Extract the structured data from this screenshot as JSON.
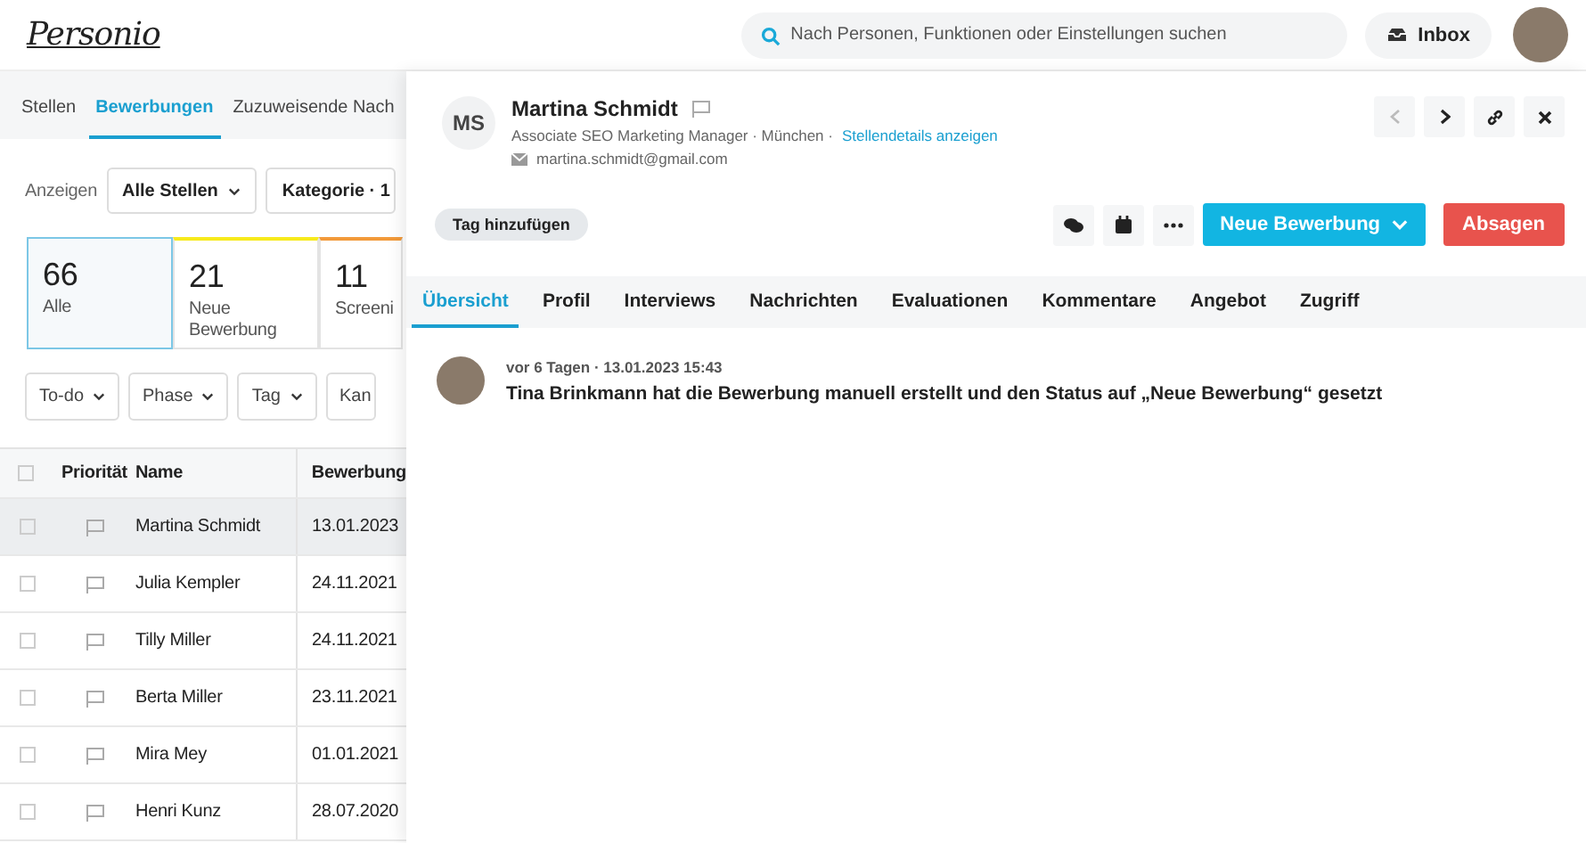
{
  "header": {
    "logo": "Personio",
    "search": {
      "placeholder": "Nach Personen, Funktionen oder Einstellungen suchen"
    },
    "inbox": "Inbox"
  },
  "tabs": [
    {
      "label": "Stellen",
      "selected": false
    },
    {
      "label": "Bewerbungen",
      "selected": true
    },
    {
      "label": "Zuzuweisende Nach",
      "selected": false
    }
  ],
  "filter": {
    "label": "Anzeigen",
    "dropdowns": [
      "Alle Stellen",
      "Kategorie · 1"
    ]
  },
  "stages": [
    {
      "count": "66",
      "label": "Alle",
      "selected": true
    },
    {
      "count": "21",
      "label": "Neue Bewerbung",
      "selected": false,
      "color": "#f7ea1c"
    },
    {
      "count": "11",
      "label": "Screeni",
      "selected": false,
      "color": "#f29a3a"
    }
  ],
  "filter_buttons": [
    "To-do",
    "Phase",
    "Tag",
    "Kan"
  ],
  "table": {
    "columns": [
      "Priorität",
      "Name",
      "Bewerbung"
    ],
    "header_checked": false,
    "rows": [
      {
        "name": "Martina Schmidt",
        "date": "13.01.2023",
        "checked": false,
        "selected": true
      },
      {
        "name": "Julia Kempler",
        "date": "24.11.2021",
        "checked": false,
        "selected": false
      },
      {
        "name": "Tilly Miller",
        "date": "24.11.2021",
        "checked": false,
        "selected": false
      },
      {
        "name": "Berta Miller",
        "date": "23.11.2021",
        "checked": false,
        "selected": false
      },
      {
        "name": "Mira Mey",
        "date": "01.01.2021",
        "checked": false,
        "selected": false
      },
      {
        "name": "Henri Kunz",
        "date": "28.07.2020",
        "checked": false,
        "selected": false
      }
    ]
  },
  "detail": {
    "initials": "MS",
    "name": "Martina Schmidt",
    "subtitle": "Associate SEO Marketing Manager · München ·",
    "job_link": "Stellendetails anzeigen",
    "email": "martina.schmidt@gmail.com",
    "tag_button": "Tag hinzufügen",
    "primary_button": "Neue Bewerbung",
    "reject_button": "Absagen",
    "tabs": [
      {
        "label": "Übersicht",
        "selected": true
      },
      {
        "label": "Profil",
        "selected": false
      },
      {
        "label": "Interviews",
        "selected": false
      },
      {
        "label": "Nachrichten",
        "selected": false
      },
      {
        "label": "Evaluationen",
        "selected": false
      },
      {
        "label": "Kommentare",
        "selected": false
      },
      {
        "label": "Angebot",
        "selected": false
      },
      {
        "label": "Zugriff",
        "selected": false
      }
    ],
    "activity": [
      {
        "meta": "vor 6 Tagen · 13.01.2023 15:43",
        "text": "Tina Brinkmann hat die Bewerbung manuell erstellt und den Status auf „Neue Bewerbung“ gesetzt"
      }
    ]
  }
}
